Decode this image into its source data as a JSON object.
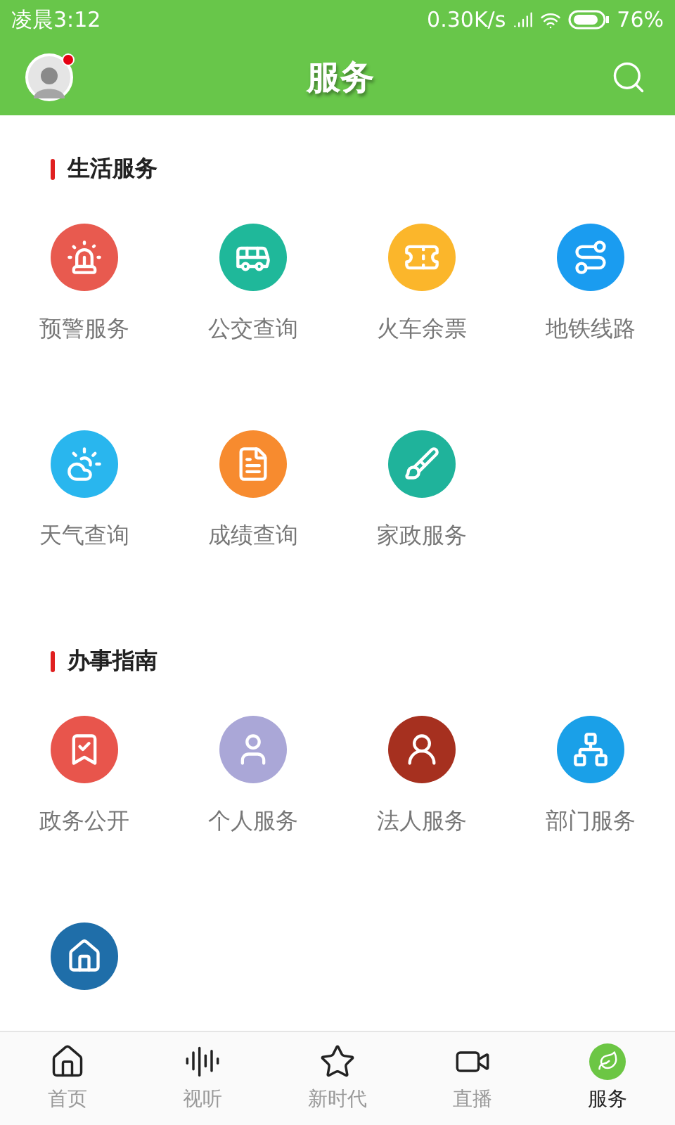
{
  "status_bar": {
    "time": "凌晨3:12",
    "speed": "0.30K/s",
    "battery": "76%"
  },
  "header": {
    "title": "服务",
    "notification_dot": true
  },
  "sections": [
    {
      "title": "生活服务",
      "items": [
        {
          "label": "预警服务",
          "kind": "siren",
          "color": "#e85a4f"
        },
        {
          "label": "公交查询",
          "kind": "bus",
          "color": "#1fb89a"
        },
        {
          "label": "火车余票",
          "kind": "ticket",
          "color": "#fbb62b"
        },
        {
          "label": "地铁线路",
          "kind": "route",
          "color": "#1a9cf0"
        },
        {
          "label": "天气查询",
          "kind": "weather",
          "color": "#29b6ee"
        },
        {
          "label": "成绩查询",
          "kind": "report",
          "color": "#f78b2f"
        },
        {
          "label": "家政服务",
          "kind": "broom",
          "color": "#1fb39b"
        }
      ]
    },
    {
      "title": "办事指南",
      "items": [
        {
          "label": "政务公开",
          "kind": "banner",
          "color": "#e8554c"
        },
        {
          "label": "个人服务",
          "kind": "person",
          "color": "#aaa7d7"
        },
        {
          "label": "法人服务",
          "kind": "contact",
          "color": "#a6301f"
        },
        {
          "label": "部门服务",
          "kind": "network",
          "color": "#1aa0e8"
        },
        {
          "kind": "house",
          "color": "#1f6ea9"
        }
      ]
    }
  ],
  "tabs": [
    {
      "label": "首页",
      "kind": "home",
      "selected": false
    },
    {
      "label": "视听",
      "kind": "audio",
      "selected": false
    },
    {
      "label": "新时代",
      "kind": "star",
      "selected": false
    },
    {
      "label": "直播",
      "kind": "video",
      "selected": false
    },
    {
      "label": "服务",
      "kind": "leaf",
      "selected": true
    }
  ]
}
